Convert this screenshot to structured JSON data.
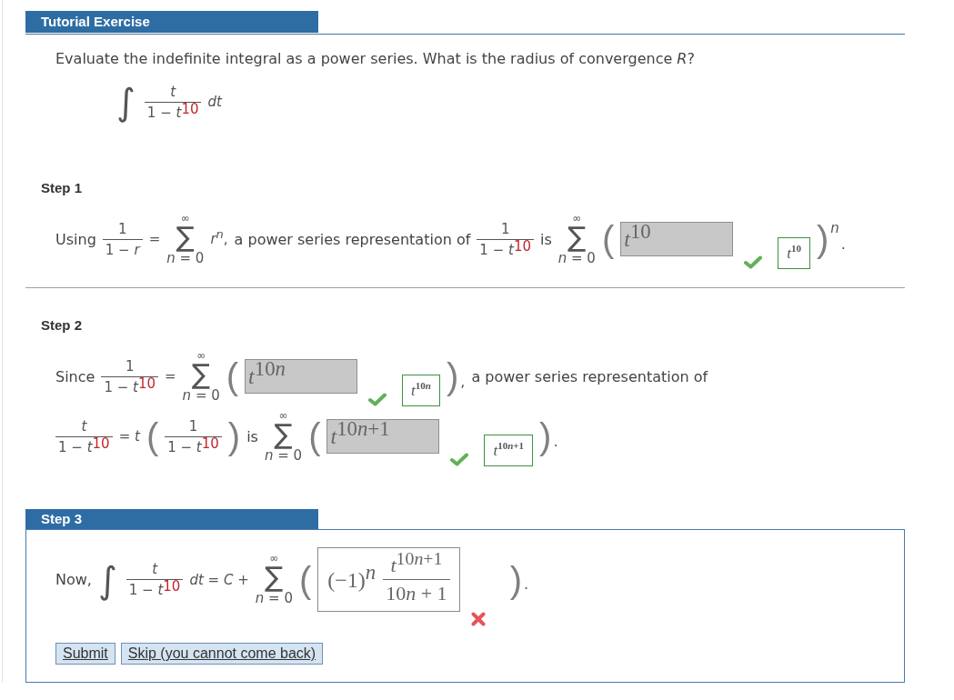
{
  "header": {
    "title": "Tutorial Exercise"
  },
  "problem": {
    "prompt": "Evaluate the indefinite integral as a power series. What is the radius of convergence *R*?",
    "integral": [
      {
        "kind": "integral",
        "sign": "∫"
      },
      {
        "kind": "frac",
        "numerator": "t",
        "denominator": "1 − t$^{10}$"
      },
      {
        "kind": "math",
        "text": "dt"
      }
    ]
  },
  "steps": [
    {
      "label": "Step 1",
      "active": false,
      "lines": [
        {
          "items": [
            {
              "kind": "word",
              "text": "Using"
            },
            {
              "kind": "frac",
              "numerator": "1",
              "denominator": "1 − r"
            },
            {
              "kind": "math",
              "text": "="
            },
            {
              "kind": "sum",
              "top": "∞",
              "sign": "∑",
              "bottom": "n = 0"
            },
            {
              "kind": "math",
              "text": "r$^{n}$,"
            },
            {
              "kind": "word",
              "text": "a power series representation of"
            },
            {
              "kind": "frac",
              "numerator": "1",
              "denominator": "1 − t$^{10}$"
            },
            {
              "kind": "word",
              "text": "is"
            },
            {
              "kind": "sum",
              "top": "∞",
              "sign": "∑",
              "bottom": "n = 0"
            },
            {
              "kind": "paren",
              "text": "("
            },
            {
              "kind": "answer",
              "disabled": true,
              "value": [
                {
                  "kind": "math",
                  "text": "t$^{10}$"
                }
              ],
              "correct": true,
              "solution": "t$^{10}$"
            },
            {
              "kind": "paren",
              "text": ")",
              "sup": "n",
              "tail": "."
            }
          ]
        }
      ]
    },
    {
      "label": "Step 2",
      "active": false,
      "lines": [
        {
          "items": [
            {
              "kind": "word",
              "text": "Since"
            },
            {
              "kind": "frac",
              "numerator": "1",
              "denominator": "1 − t$^{10}$"
            },
            {
              "kind": "math",
              "text": "="
            },
            {
              "kind": "sum",
              "top": "∞",
              "sign": "∑",
              "bottom": "n = 0"
            },
            {
              "kind": "paren",
              "text": "("
            },
            {
              "kind": "answer",
              "disabled": true,
              "value": [
                {
                  "kind": "math",
                  "text": "t$^{10n}$"
                }
              ],
              "correct": true,
              "solution": "t$^{10n}$"
            },
            {
              "kind": "paren",
              "text": ")",
              "tail": ","
            },
            {
              "kind": "word",
              "text": "a power series representation of"
            }
          ]
        },
        {
          "items": [
            {
              "kind": "frac",
              "numerator": "t",
              "denominator": "1 − t$^{10}$"
            },
            {
              "kind": "math",
              "text": "= t"
            },
            {
              "kind": "paren",
              "text": "("
            },
            {
              "kind": "frac",
              "numerator": "1",
              "denominator": "1 − t$^{10}$"
            },
            {
              "kind": "paren",
              "text": ")"
            },
            {
              "kind": "word",
              "text": "is"
            },
            {
              "kind": "sum",
              "top": "∞",
              "sign": "∑",
              "bottom": "n = 0"
            },
            {
              "kind": "paren",
              "text": "("
            },
            {
              "kind": "answer",
              "disabled": true,
              "value": [
                {
                  "kind": "math",
                  "text": "t$^{10n+1}$"
                }
              ],
              "correct": true,
              "solution": "t$^{10n+1}$"
            },
            {
              "kind": "paren",
              "text": ")",
              "tail": "."
            }
          ]
        }
      ]
    },
    {
      "label": "Step 3",
      "active": true,
      "lines": [
        {
          "items": [
            {
              "kind": "word",
              "text": "Now,"
            },
            {
              "kind": "integral",
              "sign": "∫"
            },
            {
              "kind": "frac",
              "numerator": "t",
              "denominator": "1 − t$^{10}$"
            },
            {
              "kind": "math",
              "text": "dt = C +"
            },
            {
              "kind": "sum",
              "top": "∞",
              "sign": "∑",
              "bottom": "n = 0"
            },
            {
              "kind": "paren",
              "text": "("
            },
            {
              "kind": "answer",
              "disabled": false,
              "value": [
                {
                  "kind": "math",
                  "text": "(−1)$^{n}$"
                },
                {
                  "kind": "frac",
                  "numerator": "t$^{10n+1}$",
                  "denominator": "10n + 1"
                }
              ],
              "correct": false
            },
            {
              "kind": "paren",
              "text": ")",
              "tail": "."
            }
          ]
        }
      ],
      "buttons": [
        {
          "label": "Submit"
        },
        {
          "label": "Skip (you cannot come back)"
        }
      ]
    }
  ]
}
